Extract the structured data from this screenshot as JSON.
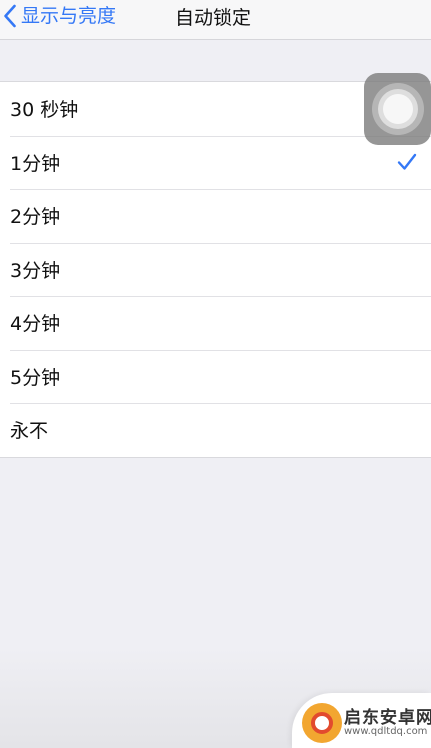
{
  "nav": {
    "back_label": "显示与亮度",
    "title": "自动锁定"
  },
  "options": [
    {
      "label": "30 秒钟",
      "selected": false
    },
    {
      "label": "1分钟",
      "selected": true
    },
    {
      "label": "2分钟",
      "selected": false
    },
    {
      "label": "3分钟",
      "selected": false
    },
    {
      "label": "4分钟",
      "selected": false
    },
    {
      "label": "5分钟",
      "selected": false
    },
    {
      "label": "永不",
      "selected": false
    }
  ],
  "colors": {
    "accent": "#3478f6",
    "background": "#efeff4"
  },
  "icons": {
    "back": "chevron-left-icon",
    "check": "checkmark-icon",
    "assistive_touch": "assistive-touch-icon",
    "watermark_logo": "watermark-logo-icon"
  },
  "watermark": {
    "name": "启东安卓网",
    "url": "www.qdltdq.com"
  }
}
